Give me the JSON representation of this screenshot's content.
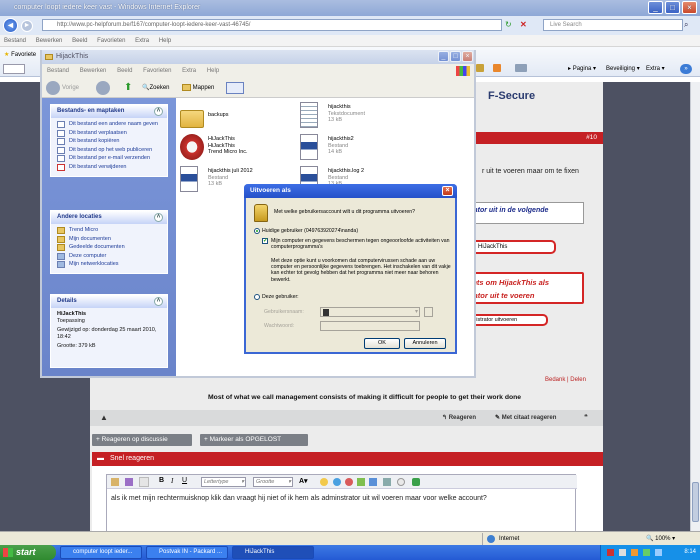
{
  "ie": {
    "title": "computer loopt iedere keer vast - Windows Internet Explorer",
    "url": "http://www.pc-helpforum.be/f167/computer-loopt-iedere-keer-vast-46745/",
    "search_placeholder": "Live Search",
    "menu": [
      "Bestand",
      "Bewerken",
      "Beeld",
      "Favorieten",
      "Extra",
      "Help"
    ],
    "fav_label": "Favoriete",
    "cmd_bar": [
      "Pagina",
      "Beveiliging",
      "Extra"
    ],
    "status_zone": "Internet",
    "zoom": "100%"
  },
  "explorer": {
    "title": "HijackThis",
    "menu": [
      "Bestand",
      "Bewerken",
      "Beeld",
      "Favorieten",
      "Extra",
      "Help"
    ],
    "back_label": "Vorige",
    "search_label": "Zoeken",
    "folders_label": "Mappen",
    "panels": {
      "tasks_title": "Bestands- en maptaken",
      "tasks": [
        "Dit bestand een andere naam geven",
        "Dit bestand verplaatsen",
        "Dit bestand kopiëren",
        "Dit bestand op het web publiceren",
        "Dit bestand per e-mail verzenden",
        "Dit bestand verwijderen"
      ],
      "places_title": "Andere locaties",
      "places": [
        "Trend Micro",
        "Mijn documenten",
        "Gedeelde documenten",
        "Deze computer",
        "Mijn netwerklocaties"
      ],
      "details_title": "Details",
      "details_name": "HiJackThis",
      "details_type": "Toepassing",
      "details_modified": "Gewijzigd op: donderdag 25 maart 2010, 18:42",
      "details_size": "Grootte: 379 kB"
    },
    "files": [
      {
        "name": "backups",
        "l2": "",
        "l3": "",
        "icon": "folder-icon"
      },
      {
        "name": "hijackthis",
        "l2": "Tekstdocument",
        "l3": "13 kB",
        "icon": "text-document-icon"
      },
      {
        "name": "HiJackThis",
        "l2": "HiJackThis",
        "l3": "Trend Micro Inc.",
        "icon": "hijackthis-app-icon"
      },
      {
        "name": "hijackthis2",
        "l2": "Bestand",
        "l3": "14 kB",
        "icon": "file-icon"
      },
      {
        "name": "hijackthis juli 2012",
        "l2": "Bestand",
        "l3": "13 kB",
        "icon": "file-icon"
      },
      {
        "name": "hijackthis.log 2",
        "l2": "Bestand",
        "l3": "13 kB",
        "icon": "file-icon"
      }
    ]
  },
  "dialog": {
    "title": "Uitvoeren als",
    "question": "Met welke gebruikersaccount wilt u dit programma uitvoeren?",
    "current_user_label": "Huidige gebruiker (049763920274\\nanda)",
    "protect_label": "Mijn computer en gegevens beschermen tegen ongeoorloofde activiteiten van computerprogramma's",
    "info": "Met deze optie kunt u voorkomen dat computervirussen schade aan uw computer en persoonlijke gegevens toebrengen. Het inschakelen van dit vakje kan echter tot gevolg hebben dat het programma niet meer naar behoren bewerkt.",
    "other_user_label": "Deze gebruiker:",
    "username_label": "Gebruikersnaam:",
    "password_label": "Wachtwoord:",
    "ok_label": "OK",
    "cancel_label": "Annuleren"
  },
  "forum": {
    "post_num": "#10",
    "logo_text": "F-Secure",
    "line1": "r uit te voeren maar om te fixen",
    "snippet1": "rator uit in de volgende",
    "snippet_tab": "HiJackThis",
    "annot_line1": "echts om HijackThis als",
    "annot_line2": "strator uit te voeren",
    "run_admin": "inistrator uitvoeren",
    "edit": "Bedank",
    "delete": "Delen",
    "signature": "Most of what we call management consists of making it difficult for people to get their work done",
    "reply": "Reageren",
    "quote_reply": "Met citaat reageren",
    "reply_thread": "+ Reageren op discussie",
    "mark_solved": "+ Markeer als OPGELOST",
    "quick_reply": "Snel reageren",
    "font_label": "Lettertype",
    "size_label": "Grootte",
    "message": "als ik met mijn rechtermuisknop klik dan vraagt hij niet of ik hem als adminstrator uit wil voeren maar voor welke account?"
  },
  "taskbar": {
    "start": "start",
    "tasks": [
      "computer loopt ieder...",
      "Postvak IN - Packard ...",
      "HiJackThis"
    ],
    "clock": "8:14"
  }
}
